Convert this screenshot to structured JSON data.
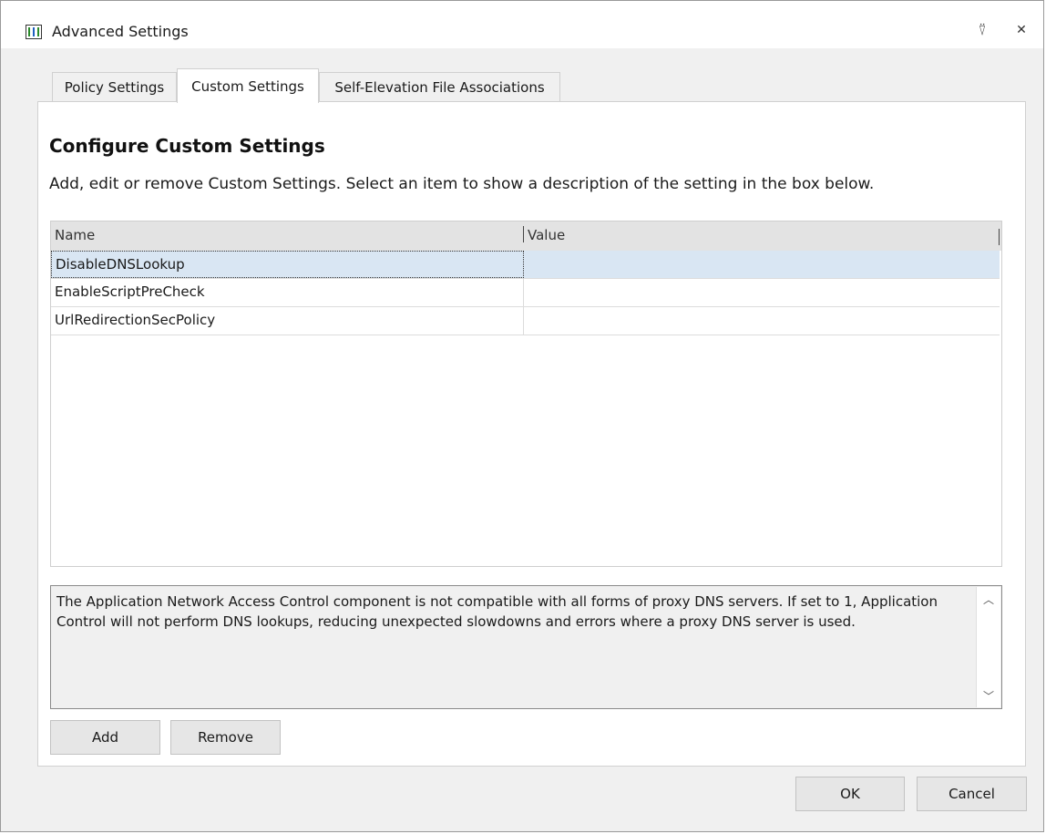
{
  "window": {
    "title": "Advanced Settings",
    "pin_glyph": "⍢",
    "close_glyph": "✕"
  },
  "tabs": [
    {
      "label": "Policy Settings",
      "active": false
    },
    {
      "label": "Custom Settings",
      "active": true
    },
    {
      "label": "Self-Elevation File Associations",
      "active": false
    }
  ],
  "panel": {
    "heading": "Configure Custom Settings",
    "subtitle": "Add, edit or remove Custom Settings. Select an item to show a description of the setting in the box below."
  },
  "grid": {
    "columns": [
      "Name",
      "Value"
    ],
    "rows": [
      {
        "name": "DisableDNSLookup",
        "value": "",
        "selected": true
      },
      {
        "name": "EnableScriptPreCheck",
        "value": "",
        "selected": false
      },
      {
        "name": "UrlRedirectionSecPolicy",
        "value": "",
        "selected": false
      }
    ]
  },
  "description": {
    "text": "The Application Network Access Control component is not compatible with all forms of proxy DNS servers. If set to 1, Application Control will not perform DNS lookups, reducing unexpected slowdowns and errors where a proxy DNS server is used.",
    "scroll_up_glyph": "︿",
    "scroll_down_glyph": "﹀"
  },
  "buttons": {
    "add": "Add",
    "remove": "Remove",
    "ok": "OK",
    "cancel": "Cancel"
  },
  "colors": {
    "selected_row": "#d9e6f3",
    "panel_bg": "#ffffff",
    "window_bg": "#f0f0f0"
  }
}
